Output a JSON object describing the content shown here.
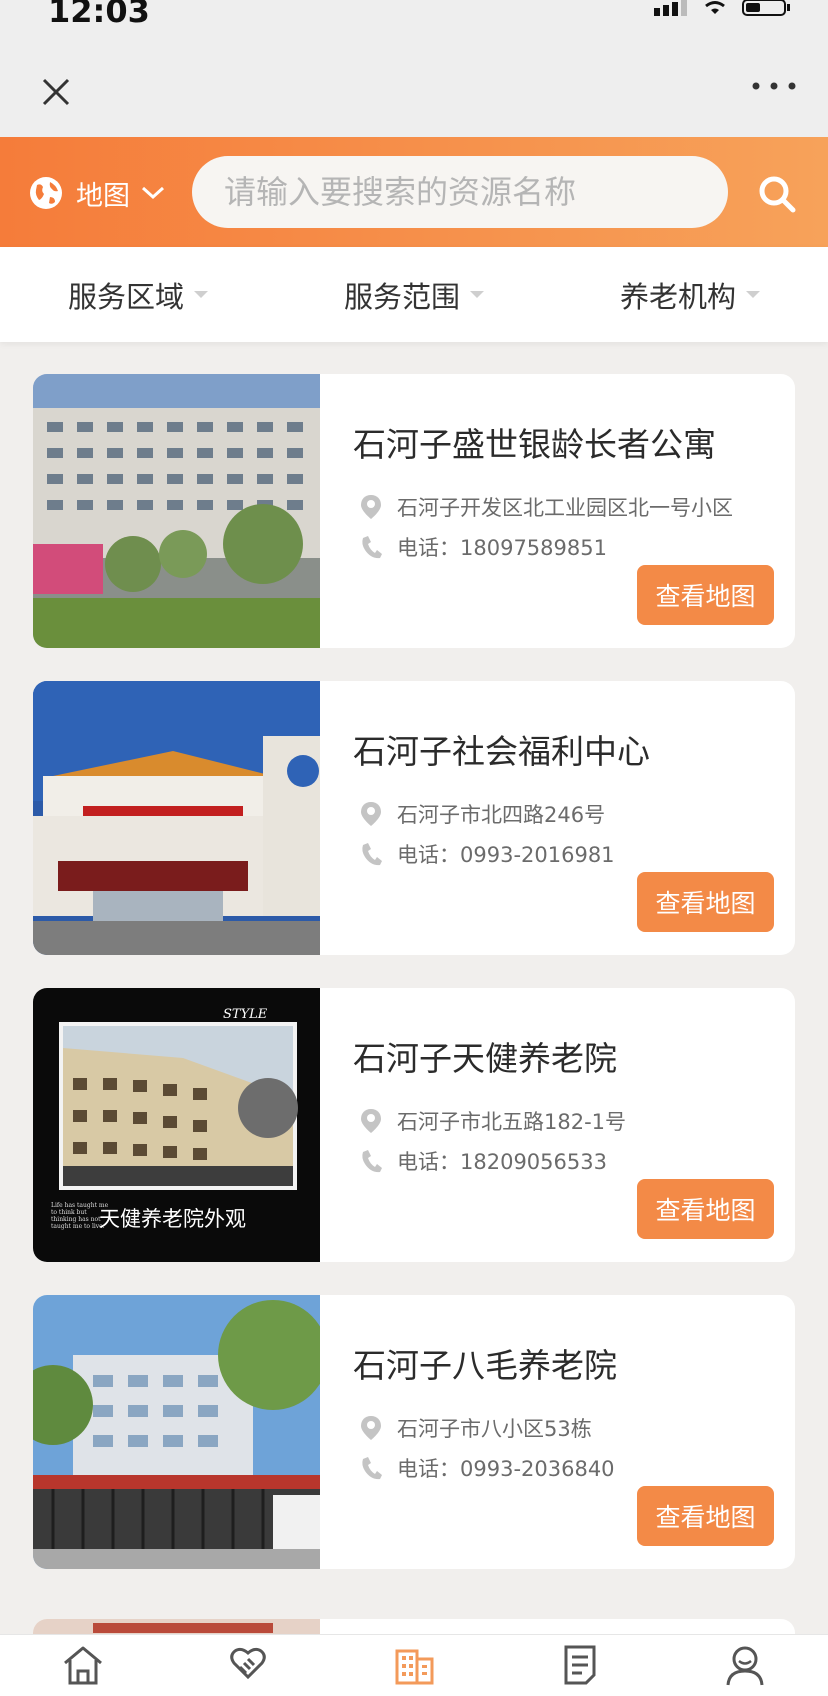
{
  "status": {
    "time": "12:03"
  },
  "search": {
    "region_label": "地图",
    "placeholder": "请输入要搜索的资源名称"
  },
  "filters": [
    "服务区域",
    "服务范围",
    "养老机构"
  ],
  "action_label": "查看地图",
  "items": [
    {
      "name": "石河子盛世银龄长者公寓",
      "address": "石河子开发区北工业园区北一号小区",
      "phone": "电话：18097589851"
    },
    {
      "name": "石河子社会福利中心",
      "address": "石河子市北四路246号",
      "phone": "电话：0993-2016981"
    },
    {
      "name": "石河子天健养老院",
      "address": "石河子市北五路182-1号",
      "phone": "电话：18209056533"
    },
    {
      "name": "石河子八毛养老院",
      "address": "石河子市八小区53栋",
      "phone": "电话：0993-2036840"
    }
  ],
  "photo_text": {
    "style_tag": "STYLE",
    "caption": "天健养老院外观",
    "quote": "Life has taught me to think but thinking has not taught me to live."
  },
  "tabs": [
    "home-icon",
    "handshake-icon",
    "building-icon",
    "document-icon",
    "user-icon"
  ],
  "colors": {
    "accent": "#f38a47",
    "gradient_start": "#f57c3a",
    "gradient_end": "#f7a25a",
    "active_tab": "#f39a5a",
    "inactive_tab": "#555555"
  }
}
